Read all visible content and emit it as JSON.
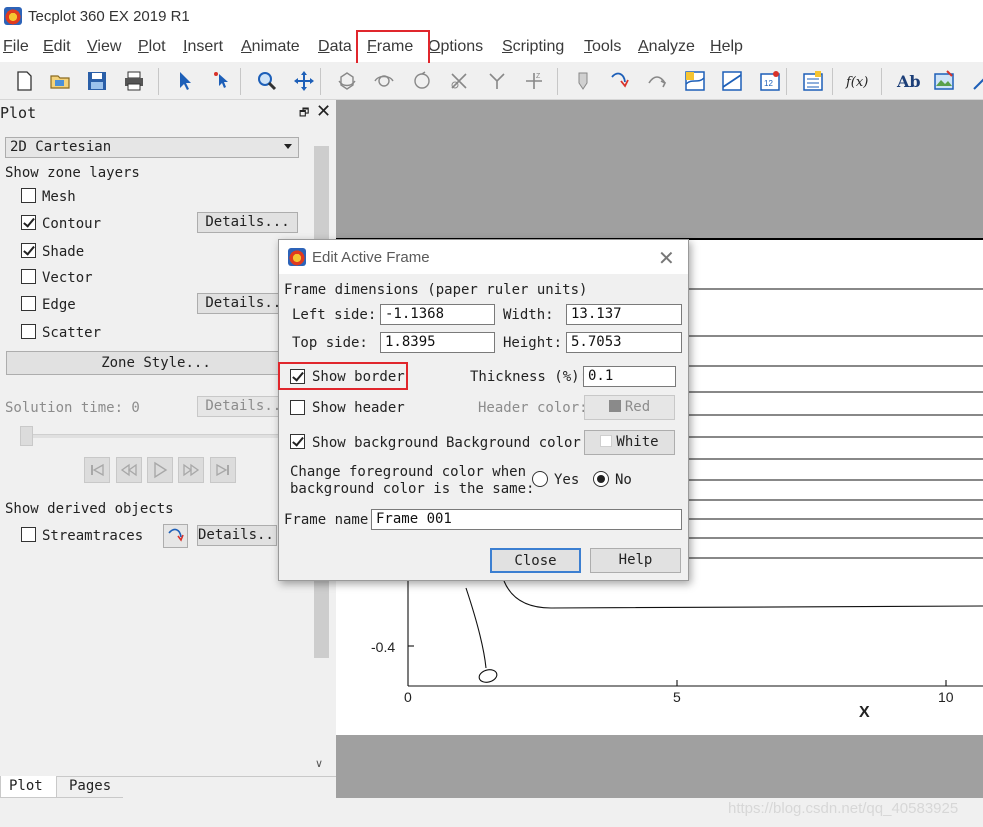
{
  "window": {
    "title": "Tecplot 360 EX 2019 R1"
  },
  "menubar": {
    "items": [
      {
        "label": "File",
        "key": "F",
        "rest": "ile"
      },
      {
        "label": "Edit",
        "key": "E",
        "rest": "dit"
      },
      {
        "label": "View",
        "key": "V",
        "rest": "iew"
      },
      {
        "label": "Plot",
        "key": "P",
        "rest": "lot"
      },
      {
        "label": "Insert",
        "key": "I",
        "rest": "nsert"
      },
      {
        "label": "Animate",
        "key": "A",
        "rest": "nimate"
      },
      {
        "label": "Data",
        "key": "D",
        "rest": "ata"
      },
      {
        "label": "Frame",
        "key": "F",
        "rest": "rame"
      },
      {
        "label": "Options",
        "key": "O",
        "rest": "ptions"
      },
      {
        "label": "Scripting",
        "key": "S",
        "rest": "cripting"
      },
      {
        "label": "Tools",
        "key": "T",
        "rest": "ools"
      },
      {
        "label": "Analyze",
        "key": "A",
        "rest": "nalyze"
      },
      {
        "label": "Help",
        "key": "H",
        "rest": "elp"
      }
    ],
    "highlighted": "Frame",
    "highlight_color": "#e0262c"
  },
  "toolbar": {
    "icons": [
      "new-layout-icon",
      "open-icon",
      "save-icon",
      "print-icon",
      "select-pointer-icon",
      "adjustor-icon",
      "zoom-icon",
      "translate-icon",
      "rotate-3d-icon",
      "rollerball-icon",
      "spherical-rotate-icon",
      "rotate-x-icon",
      "rotate-y-icon",
      "rotate-z-icon",
      "probe-icon",
      "streamtrace-icon",
      "slice-icon",
      "contour-add-icon",
      "contour-remove-icon",
      "contour-labels-icon",
      "data-edit-icon",
      "equation-icon",
      "text-icon",
      "image-icon",
      "line-icon"
    ],
    "equation_glyph": "f(x)",
    "text_glyph": "Ab"
  },
  "panel": {
    "title": "Plot",
    "float_glyph": "🗗",
    "close_glyph": "✕",
    "plot_type": "2D Cartesian",
    "zone_layers_heading": "Show zone layers",
    "layers": [
      {
        "label": "Mesh",
        "checked": false,
        "details": false
      },
      {
        "label": "Contour",
        "checked": true,
        "details": true
      },
      {
        "label": "Shade",
        "checked": true,
        "details": false
      },
      {
        "label": "Vector",
        "checked": false,
        "details": false
      },
      {
        "label": "Edge",
        "checked": false,
        "details": true
      },
      {
        "label": "Scatter",
        "checked": false,
        "details": false
      }
    ],
    "details_label": "Details...",
    "zone_style_label": "Zone Style...",
    "solution_time_label": "Solution time: 0",
    "derived_heading": "Show derived objects",
    "streamtraces_label": "Streamtraces",
    "streamtraces_checked": false,
    "tabs": {
      "plot": "Plot",
      "pages": "Pages"
    }
  },
  "plot_area": {
    "y_tick": "-0.4",
    "x_ticks": [
      "0",
      "5",
      "10"
    ],
    "x_axis_label": "X"
  },
  "dialog": {
    "title": "Edit Active Frame",
    "close_glyph": "✕",
    "dimensions_heading": "Frame dimensions (paper ruler units)",
    "left_side_label": "Left side:",
    "left_side_value": "-1.1368",
    "width_label": "Width:",
    "width_value": "13.137",
    "top_side_label": "Top side:",
    "top_side_value": "1.8395",
    "height_label": "Height:",
    "height_value": "5.7053",
    "show_border_label": "Show border",
    "show_border_checked": true,
    "thickness_label": "Thickness (%):",
    "thickness_value": "0.1",
    "show_header_label": "Show header",
    "show_header_checked": false,
    "header_color_label": "Header color:",
    "header_color_value": "Red",
    "header_color_hex": "#8a8a8a",
    "show_background_label": "Show background",
    "show_background_checked": true,
    "background_color_label": "Background color:",
    "background_color_value": "White",
    "background_color_hex": "#ffffff",
    "fg_change_line1": "Change foreground color when",
    "fg_change_line2": "background color is the same:",
    "yes_label": "Yes",
    "no_label": "No",
    "fg_change_selected": "No",
    "frame_name_label": "Frame name",
    "frame_name_value": "Frame 001",
    "close_button": "Close",
    "help_button": "Help"
  },
  "watermark": "https://blog.csdn.net/qq_40583925"
}
